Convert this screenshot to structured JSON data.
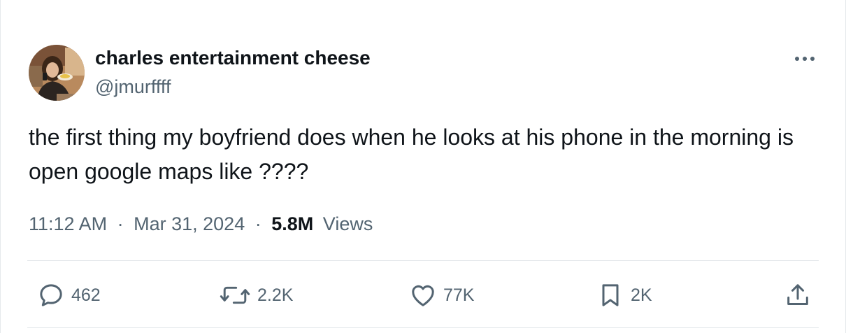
{
  "previous_tweet": {
    "partial_text": "...."
  },
  "tweet": {
    "author": {
      "display_name": "charles entertainment cheese",
      "handle": "@jmurffff",
      "avatar_icon": "profile-photo"
    },
    "menu_icon": "more-dots-icon",
    "text": "the first thing my boyfriend does when he looks at his phone in the morning is open google maps like ????",
    "time": "11:12 AM",
    "date": "Mar 31, 2024",
    "separator": "·",
    "views": {
      "count": "5.8M",
      "label": "Views"
    },
    "actions": {
      "reply": {
        "icon": "reply-bubble-icon",
        "count": "462"
      },
      "retweet": {
        "icon": "retweet-icon",
        "count": "2.2K"
      },
      "like": {
        "icon": "heart-icon",
        "count": "77K"
      },
      "bookmark": {
        "icon": "bookmark-icon",
        "count": "2K"
      },
      "share": {
        "icon": "share-icon"
      }
    }
  },
  "colors": {
    "text_primary": "#0f1419",
    "text_secondary": "#536471",
    "divider": "#e3e7ea"
  }
}
